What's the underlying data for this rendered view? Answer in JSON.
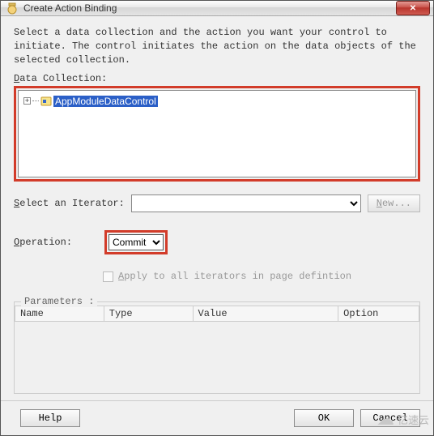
{
  "window": {
    "title": "Create Action Binding",
    "close_symbol": "✕"
  },
  "intro": "Select a data collection and the action you want your control to initiate. The control initiates the action on the data objects of the selected collection.",
  "labels": {
    "data_collection": "Data Collection:",
    "select_iterator": "Select an Iterator:",
    "operation": "Operation:",
    "apply_all": "Apply to all iterators in page defintion",
    "parameters": "Parameters :",
    "new_btn": "New...",
    "help": "Help",
    "ok": "OK",
    "cancel": "Cancel"
  },
  "tree": {
    "expander": "+",
    "root": "AppModuleDataControl"
  },
  "iterator": {
    "value": ""
  },
  "operation": {
    "selected": "Commit",
    "options": [
      "Commit"
    ]
  },
  "params": {
    "columns": [
      "Name",
      "Type",
      "Value",
      "Option"
    ]
  },
  "watermark": "亿速云"
}
